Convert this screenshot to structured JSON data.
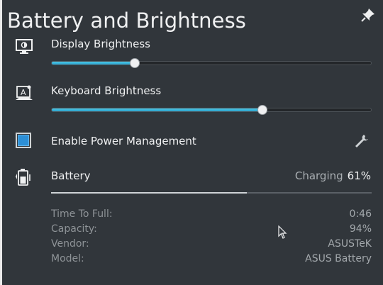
{
  "window": {
    "title": "Battery and Brightness"
  },
  "display": {
    "label": "Display Brightness",
    "value_percent": 26
  },
  "keyboard": {
    "label": "Keyboard Brightness",
    "value_percent": 66
  },
  "power": {
    "label": "Enable Power Management",
    "checked": true
  },
  "battery": {
    "label": "Battery",
    "status": "Charging",
    "percent_text": "61%",
    "charge_fraction": 0.61,
    "details": [
      {
        "key": "Time To Full:",
        "value": "0:46"
      },
      {
        "key": "Capacity:",
        "value": "94%"
      },
      {
        "key": "Vendor:",
        "value": "ASUSTeK"
      },
      {
        "key": "Model:",
        "value": "ASUS Battery"
      }
    ]
  },
  "colors": {
    "panel_bg": "#31363b",
    "accent": "#3daee9",
    "text": "#eff0f1"
  },
  "icons": {
    "pin": "pin-icon",
    "display": "display-brightness-icon",
    "keyboard": "keyboard-brightness-icon",
    "wrench": "wrench-icon",
    "battery": "battery-icon"
  }
}
